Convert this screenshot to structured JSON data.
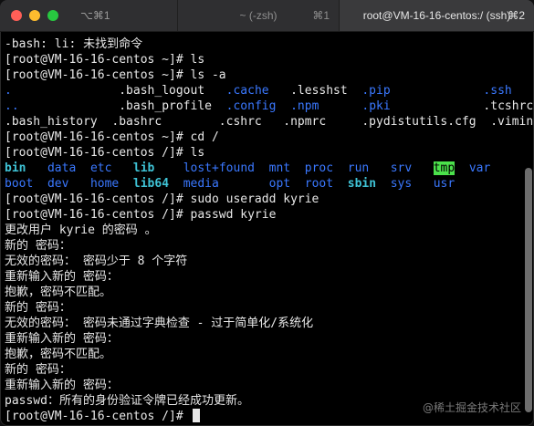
{
  "window": {
    "tabs": [
      {
        "label": "",
        "shortcut": "⌥⌘1"
      },
      {
        "label": "~ (-zsh)",
        "shortcut": "⌘1"
      },
      {
        "label": "root@VM-16-16-centos:/ (ssh)",
        "shortcut": "⌘2"
      }
    ]
  },
  "terminal": {
    "lines": [
      [
        {
          "t": "-bash: li: 未找到命令"
        }
      ],
      [
        {
          "t": "[root@VM-16-16-centos ~]# ls"
        }
      ],
      [
        {
          "t": "[root@VM-16-16-centos ~]# ls -a"
        }
      ],
      [
        {
          "t": ".",
          "c": "blue"
        },
        {
          "t": "               .bash_logout   "
        },
        {
          "t": ".cache",
          "c": "blue"
        },
        {
          "t": "   .lesshst  "
        },
        {
          "t": ".pip",
          "c": "blue"
        },
        {
          "t": "             "
        },
        {
          "t": ".ssh",
          "c": "blue"
        }
      ],
      [
        {
          "t": "..",
          "c": "blue"
        },
        {
          "t": "              .bash_profile  "
        },
        {
          "t": ".config",
          "c": "blue"
        },
        {
          "t": "  "
        },
        {
          "t": ".npm",
          "c": "blue"
        },
        {
          "t": "      "
        },
        {
          "t": ".pki",
          "c": "blue"
        },
        {
          "t": "             .tcshrc"
        }
      ],
      [
        {
          "t": ".bash_history  .bashrc        .cshrc   .npmrc     .pydistutils.cfg  .viminfo"
        }
      ],
      [
        {
          "t": "[root@VM-16-16-centos ~]# cd /"
        }
      ],
      [
        {
          "t": "[root@VM-16-16-centos /]# ls"
        }
      ],
      [
        {
          "t": "bin",
          "c": "cyan"
        },
        {
          "t": "   "
        },
        {
          "t": "data",
          "c": "blue"
        },
        {
          "t": "  "
        },
        {
          "t": "etc",
          "c": "blue"
        },
        {
          "t": "   "
        },
        {
          "t": "lib",
          "c": "cyan"
        },
        {
          "t": "    "
        },
        {
          "t": "lost+found",
          "c": "blue"
        },
        {
          "t": "  "
        },
        {
          "t": "mnt",
          "c": "blue"
        },
        {
          "t": "  "
        },
        {
          "t": "proc",
          "c": "blue"
        },
        {
          "t": "  "
        },
        {
          "t": "run",
          "c": "blue"
        },
        {
          "t": "   "
        },
        {
          "t": "srv",
          "c": "blue"
        },
        {
          "t": "   "
        },
        {
          "t": "tmp",
          "c": "tmp"
        },
        {
          "t": "  "
        },
        {
          "t": "var",
          "c": "blue"
        }
      ],
      [
        {
          "t": "boot",
          "c": "blue"
        },
        {
          "t": "  "
        },
        {
          "t": "dev",
          "c": "blue"
        },
        {
          "t": "   "
        },
        {
          "t": "home",
          "c": "blue"
        },
        {
          "t": "  "
        },
        {
          "t": "lib64",
          "c": "cyan"
        },
        {
          "t": "  "
        },
        {
          "t": "media",
          "c": "blue"
        },
        {
          "t": "       "
        },
        {
          "t": "opt",
          "c": "blue"
        },
        {
          "t": "  "
        },
        {
          "t": "root",
          "c": "blue"
        },
        {
          "t": "  "
        },
        {
          "t": "sbin",
          "c": "cyan"
        },
        {
          "t": "  "
        },
        {
          "t": "sys",
          "c": "blue"
        },
        {
          "t": "   "
        },
        {
          "t": "usr",
          "c": "blue"
        }
      ],
      [
        {
          "t": "[root@VM-16-16-centos /]# sudo useradd kyrie"
        }
      ],
      [
        {
          "t": "[root@VM-16-16-centos /]# passwd kyrie"
        }
      ],
      [
        {
          "t": "更改用户 kyrie 的密码 。"
        }
      ],
      [
        {
          "t": "新的 密码："
        }
      ],
      [
        {
          "t": "无效的密码： 密码少于 8 个字符"
        }
      ],
      [
        {
          "t": "重新输入新的 密码："
        }
      ],
      [
        {
          "t": "抱歉，密码不匹配。"
        }
      ],
      [
        {
          "t": "新的 密码："
        }
      ],
      [
        {
          "t": "无效的密码： 密码未通过字典检查 - 过于简单化/系统化"
        }
      ],
      [
        {
          "t": "重新输入新的 密码："
        }
      ],
      [
        {
          "t": "抱歉，密码不匹配。"
        }
      ],
      [
        {
          "t": "新的 密码："
        }
      ],
      [
        {
          "t": "重新输入新的 密码："
        }
      ],
      [
        {
          "t": "passwd：所有的身份验证令牌已经成功更新。"
        }
      ],
      [
        {
          "t": "[root@VM-16-16-centos /]# "
        }
      ]
    ]
  },
  "watermark": "@稀土掘金技术社区"
}
